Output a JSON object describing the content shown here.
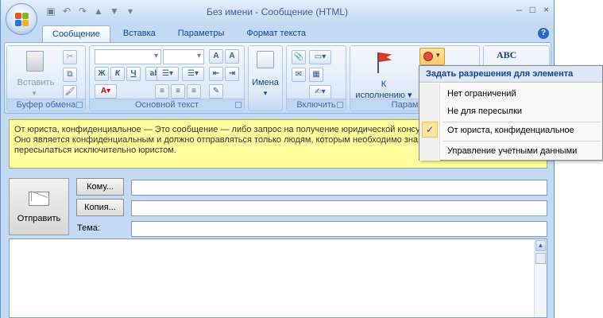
{
  "window": {
    "title": "Без имени - Сообщение (HTML)",
    "minimize": "–",
    "maximize": "□",
    "close": "×"
  },
  "qat": {
    "save": "💾",
    "undo": "↶",
    "redo": "↷",
    "up": "▲",
    "down": "▼",
    "customize": "▾"
  },
  "tabs": [
    "Сообщение",
    "Вставка",
    "Параметры",
    "Формат текста"
  ],
  "help": "?",
  "ribbon": {
    "clipboard": {
      "label": "Буфер обмена",
      "paste": "Вставить"
    },
    "basic_text": {
      "label": "Основной текст"
    },
    "names": {
      "label": "Имена"
    },
    "include": {
      "label": "Включить"
    },
    "options": {
      "label": "Параметры",
      "followup_line1": "К",
      "followup_line2": "исполнению ▾"
    }
  },
  "infobar": {
    "line1": "От юриста, конфиденциальное — Это сообщение — либо запрос на получение юридической консул",
    "line2": "Оно является конфиденциальным и должно отправляться только людям, которым необходимо зна",
    "line3": "пересылаться исключительно юристом."
  },
  "header": {
    "send": "Отправить",
    "to": "Кому...",
    "cc": "Копия...",
    "subject_label": "Тема:",
    "to_value": "",
    "cc_value": "",
    "subject_value": ""
  },
  "permissions_menu": {
    "header": "Задать разрешения для элемента",
    "items": [
      {
        "label": "Нет ограничений",
        "checked": false
      },
      {
        "label": "Не для пересылки",
        "checked": false
      },
      {
        "label": "От юриста, конфиденциальное",
        "checked": true
      },
      {
        "label": "Управление учетными данными",
        "checked": false
      }
    ]
  },
  "colors": {
    "ribbon_blue": "#c4d9f3",
    "infobar_yellow": "#ffff9e",
    "text_blue": "#15428b"
  }
}
